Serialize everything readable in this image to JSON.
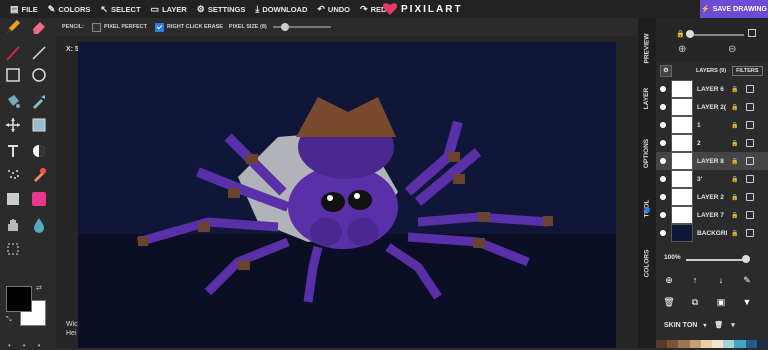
{
  "topbar": {
    "menu": [
      {
        "icon": "file-icon",
        "label": "FILE"
      },
      {
        "icon": "colors-icon",
        "label": "COLORS"
      },
      {
        "icon": "select-icon",
        "label": "SELECT"
      },
      {
        "icon": "layer-icon",
        "label": "LAYER"
      },
      {
        "icon": "gear-icon",
        "label": "SETTINGS"
      },
      {
        "icon": "download-icon",
        "label": "DOWNLOAD"
      },
      {
        "icon": "undo-icon",
        "label": "UNDO"
      },
      {
        "icon": "redo-icon",
        "label": "REDO"
      }
    ],
    "logo_text": "PIXILART",
    "save_label": "SAVE DRAWING"
  },
  "subbar": {
    "pencil_label": "PENCIL:",
    "pixel_perfect": "PIXEL PERFECT",
    "pixel_perfect_checked": false,
    "right_click_erase": "RIGHT CLICK ERASE",
    "right_click_erase_checked": true,
    "pixel_size_label": "PIXEL SIZE (8)",
    "pixel_size_value": 8
  },
  "canvas": {
    "coord_text": "X: 5",
    "dims_line1": "Wic",
    "dims_line2": "Hei",
    "background_color": "#0f1638"
  },
  "side_tabs": [
    "PREVIEW",
    "LAYER",
    "OPTIONS",
    "TOOL",
    "COLORS"
  ],
  "layers": {
    "header": "LAYERS (9)",
    "filters_label": "FILTERS",
    "items": [
      {
        "name": "LAYER 6",
        "selected": false
      },
      {
        "name": "LAYER 2(",
        "selected": false
      },
      {
        "name": "1",
        "selected": false
      },
      {
        "name": "2",
        "selected": false
      },
      {
        "name": "LAYER 8",
        "selected": true
      },
      {
        "name": "3'",
        "selected": false
      },
      {
        "name": "LAYER 2",
        "selected": false
      },
      {
        "name": "LAYER 7",
        "selected": false
      },
      {
        "name": "BACKGRI",
        "selected": false
      }
    ],
    "opacity_label": "100%",
    "opacity_value": 1.0
  },
  "palette": {
    "name": "SKIN TON",
    "colors": [
      "#5a3a2a",
      "#7a5236",
      "#a0744e",
      "#c7a07a",
      "#e9cfa8",
      "#f6e6cf",
      "#9fd6d6",
      "#4aa3c7",
      "#2a5a8a",
      "#1a2d4a"
    ]
  },
  "colors": {
    "accent": "#6b4cd6",
    "fg_swatch": "#000000",
    "bg_swatch": "#ffffff"
  }
}
